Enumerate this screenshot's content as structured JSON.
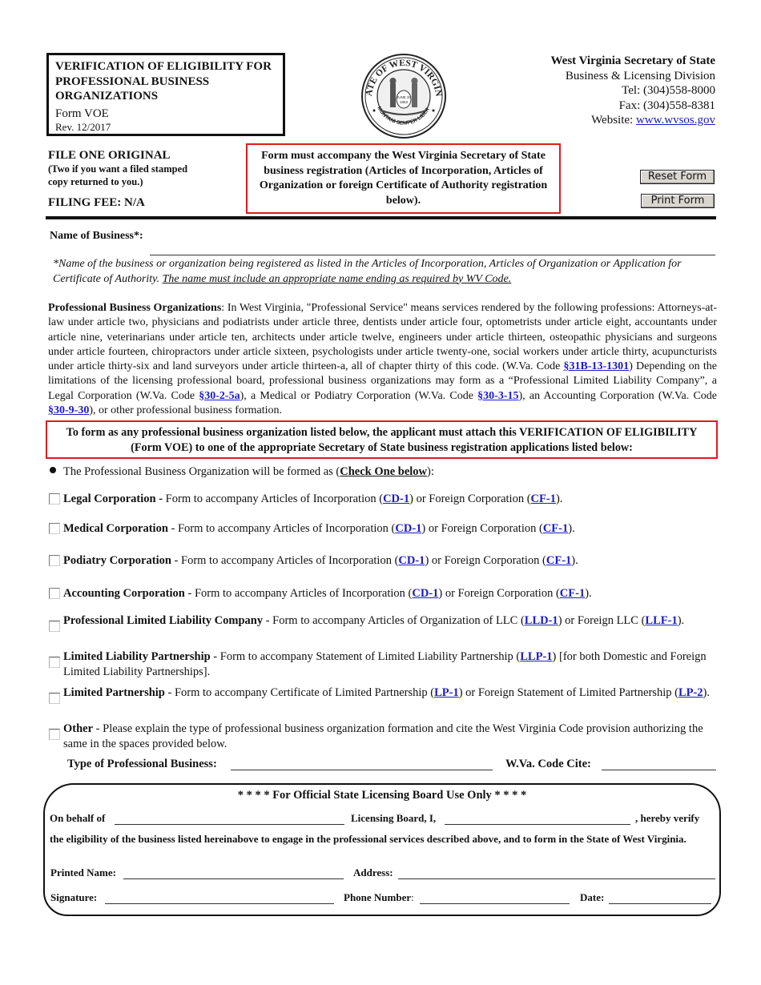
{
  "header": {
    "title_lines": [
      "VERIFICATION OF ELIGIBILITY FOR",
      "PROFESSIONAL BUSINESS",
      "ORGANIZATIONS"
    ],
    "form_id": "Form VOE",
    "revision": "Rev. 12/2017",
    "seal": {
      "icon": "state-seal-icon",
      "top_text": "STATE OF WEST VIRGINIA",
      "bottom_text": "MONTANI SEMPER LIBERI",
      "center_text": "JUNE 20 1863"
    },
    "agency": {
      "name": "West Virginia Secretary of State",
      "division": "Business & Licensing Division",
      "tel": "Tel: (304)558-8000",
      "fax": "Fax: (304)558-8381",
      "website_label": "Website: ",
      "website_link": "www.wvsos.gov"
    }
  },
  "filing": {
    "heading": "FILE ONE ORIGINAL",
    "sub_line1": "(Two if you want a filed stamped",
    "sub_line2": "copy returned to you.)",
    "fee": "FILING FEE:  N/A"
  },
  "accompany_notice": "Form must accompany the West Virginia Secretary of State business registration (Articles of Incorporation, Articles of Organization or foreign Certificate of Authority registration below).",
  "buttons": {
    "reset": "Reset Form",
    "print": "Print Form"
  },
  "name_of_business": {
    "label": "Name of Business*:",
    "value": ""
  },
  "name_note": {
    "text": "*Name of the business or organization being registered as listed in the Articles of Incorporation, Articles of Organization or Application for Certificate of Authority. ",
    "underlined": "The name must include an appropriate name ending as required by WV Code."
  },
  "pbo": {
    "bold_lead": "Professional Business Organizations",
    "text1": ": In West Virginia, \"Professional Service\" means services rendered by the following professions: Attorneys-at-law under article two, physicians and podiatrists under article three, dentists under article four, optometrists under article eight, accountants under article nine, veterinarians under article ten, architects under article twelve, engineers under article thirteen, osteopathic physicians and surgeons under article fourteen, chiropractors under article sixteen, psychologists under article twenty-one, social workers under article thirty, acupuncturists under article thirty-six and land surveyors under article thirteen-a, all of chapter thirty of this code. (W.Va. Code ",
    "link1": "§31B-13-1301",
    "text2": ") Depending on the limitations of the licensing professional board, professional business organizations may form as a “Professional Limited Liability Company”, a Legal Corporation (W.Va. Code ",
    "link2": "§30-2-5a",
    "text3": "), a Medical or Podiatry Corporation (W.Va. Code ",
    "link3": "§30-3-15",
    "text4": "), an Accounting Corporation (W.Va. Code ",
    "link4": "§30-9-30",
    "text5": "), or other professional business formation."
  },
  "attach_notice": "To form as any professional business organization listed below, the applicant must attach this VERIFICATION OF ELIGIBILITY (Form VOE) to one of the appropriate Secretary of State business registration applications listed below:",
  "formed_as": {
    "text": "The Professional Business Organization will be formed as (",
    "check_one": "Check One below",
    "tail": "):"
  },
  "options": [
    {
      "name": "Legal Corporation -",
      "pre": " Form to accompany Articles of Incorporation (",
      "link1": "CD-1",
      "mid": ") or Foreign Corporation (",
      "link2": "CF-1",
      "post": ").",
      "checked": false
    },
    {
      "name": "Medical Corporation",
      "pre": " - Form to accompany Articles of Incorporation (",
      "link1": "CD-1",
      "mid": ") or Foreign Corporation (",
      "link2": "CF-1",
      "post": ").",
      "checked": false
    },
    {
      "name": "Podiatry Corporation",
      "pre": " - Form to accompany Articles of Incorporation (",
      "link1": "CD-1",
      "mid": ") or Foreign Corporation (",
      "link2": "CF-1",
      "post": ").",
      "checked": false
    },
    {
      "name": "Accounting Corporation",
      "pre": " - Form to accompany Articles of Incorporation (",
      "link1": "CD-1",
      "mid": ") or Foreign Corporation (",
      "link2": "CF-1",
      "post": ").",
      "checked": false
    },
    {
      "name": "Professional Limited Liability Company",
      "pre": " - Form to accompany Articles of Organization of LLC (",
      "link1": "LLD-1",
      "mid": ") or Foreign LLC (",
      "link2": "LLF-1",
      "post": ").",
      "checked": false
    },
    {
      "name": "Limited Liability Partnership",
      "pre": " - Form to accompany Statement of Limited Liability Partnership (",
      "link1": "LLP-1",
      "mid": ") [for both Domestic and Foreign Limited Liability Partnerships].",
      "checked": false
    },
    {
      "name": "Limited Partnership",
      "pre": " - Form to accompany Certificate of Limited Partnership (",
      "link1": "LP-1",
      "mid": ") or Foreign Statement of Limited Partnership (",
      "link2": "LP-2",
      "post": ").",
      "checked": false
    },
    {
      "name": "Other",
      "pre": " - Please explain the type of professional business organization formation and cite the West Virginia Code provision authorizing the same in the spaces provided below.",
      "checked": false
    }
  ],
  "type_row": {
    "type_label": "Type of Professional Business:",
    "type_value": "",
    "code_label": "W.Va. Code Cite:",
    "code_value": ""
  },
  "official": {
    "title": "* * * *  For Official State Licensing Board Use Only  * * * *",
    "on_behalf_label": "On behalf of",
    "licensing_board_label": "Licensing Board, I,",
    "hereby_verify": ", hereby verify",
    "verify_text": "the eligibility of the business listed hereinabove to engage in the professional services described above, and to form in the State of West Virginia.",
    "printed_name_label": "Printed Name:",
    "address_label": "Address:",
    "signature_label": "Signature:",
    "phone_label": "Phone Number",
    "phone_colon": ":",
    "date_label": "Date:"
  },
  "colors": {
    "notice_border": "#e01b1b",
    "link": "#1a1acc"
  }
}
